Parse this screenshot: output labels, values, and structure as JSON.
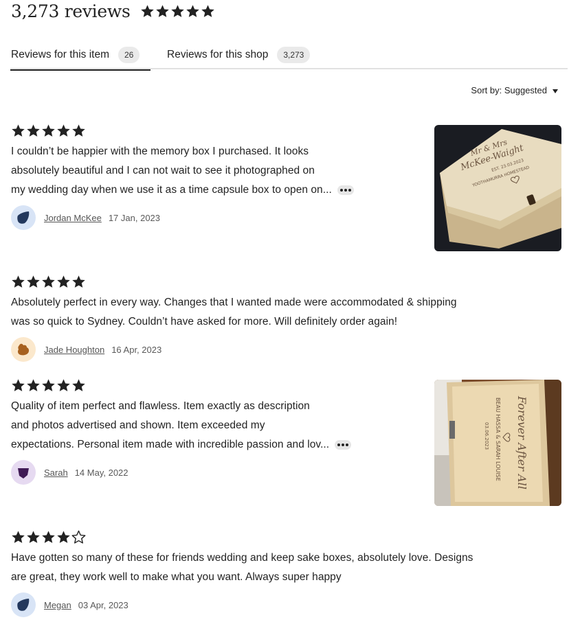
{
  "header": {
    "review_count": "3,273 reviews",
    "rating": 5
  },
  "tabs": [
    {
      "label": "Reviews for this item",
      "count": "26",
      "active": true
    },
    {
      "label": "Reviews for this shop",
      "count": "3,273",
      "active": false
    }
  ],
  "sort": {
    "label": "Sort by: Suggested"
  },
  "reviews": [
    {
      "rating": 5,
      "lines": [
        "I couldn’t be happier with the memory box I purchased. It looks",
        "absolutely beautiful and I can not wait to see it photographed on",
        "my wedding day when we use it as a time capsule box to open on..."
      ],
      "truncated": true,
      "author": "Jordan McKee",
      "date": "17 Jan, 2023",
      "avatar_color": "#d8e4f6",
      "avatar_shape_color": "#23385d",
      "photo": {
        "engraving_lines": [
          "Mr & Mrs",
          "McKee-Waight",
          "EST. 23.03.2023",
          "YOOTHAMURRA HOMESTEAD"
        ]
      }
    },
    {
      "rating": 5,
      "lines": [
        "Absolutely perfect in every way. Changes that I wanted made were accommodated & shipping",
        "was so quick to Sydney. Couldn’t have asked for more. Will definitely order again!"
      ],
      "truncated": false,
      "author": "Jade Houghton",
      "date": "16 Apr, 2023",
      "avatar_color": "#fbe8cc",
      "avatar_shape_color": "#a7611f"
    },
    {
      "rating": 5,
      "lines": [
        "Quality of item perfect and flawless. Item exactly as description",
        "and photos advertised and shown. Item exceeded my",
        "expectations. Personal item made with incredible passion and lov..."
      ],
      "truncated": true,
      "author": "Sarah",
      "date": "14 May, 2022",
      "avatar_color": "#e6daf1",
      "avatar_shape_color": "#3f1a55",
      "photo": {
        "engraving_lines": [
          "Forever After All",
          "BEAU HASSA & SARAH LOUISE",
          "03.06.2023"
        ]
      }
    },
    {
      "rating": 4,
      "lines": [
        "Have gotten so many of these for friends wedding and keep sake boxes, absolutely love. Designs",
        "are great, they work well to make what you want. Always super happy"
      ],
      "truncated": false,
      "author": "Megan",
      "date": "03 Apr, 2023",
      "avatar_color": "#d8e4f6",
      "avatar_shape_color": "#23385d"
    }
  ]
}
